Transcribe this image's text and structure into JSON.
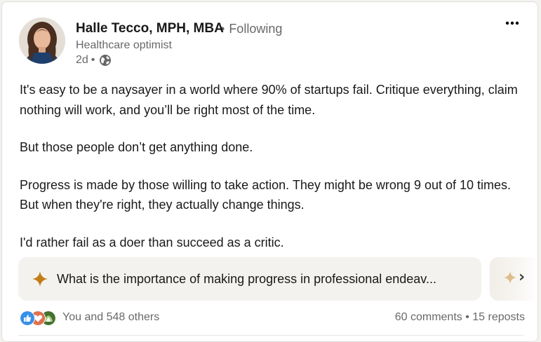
{
  "post": {
    "author": {
      "name": "Halle Tecco, MPH, MBA",
      "follow_status": "Following",
      "headline": "Healthcare optimist",
      "posted_ago": "2d",
      "visibility_icon": "globe-icon"
    },
    "more_icon": "ellipsis-icon",
    "body": [
      "It's easy to be a naysayer in a world where 90% of startups fail. Critique everything, claim nothing will work, and you’ll be right most of the time.",
      "But those people don’t get anything done.",
      "Progress is made by those willing to take action. They might be wrong 9 out of 10 times. But when they're right, they actually change things.",
      "I'd rather fail as a doer than succeed as a critic."
    ],
    "ai_prompt": {
      "icon": "sparkle-icon",
      "text": "What is the importance of making progress in professional endeav..."
    },
    "social": {
      "reaction_icons": [
        "like-icon",
        "love-icon",
        "support-icon"
      ],
      "reactions_label": "You and 548 others",
      "comments": "60 comments",
      "reposts": "15 reposts"
    }
  },
  "colors": {
    "like": "#378fe9",
    "love": "#df704d",
    "support": "#44712e",
    "sparkle": "#c37d16"
  }
}
